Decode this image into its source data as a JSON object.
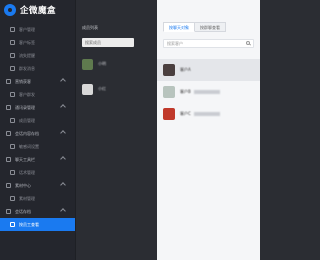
{
  "brand": {
    "title": "企微魔盒"
  },
  "sidebar": {
    "items": [
      {
        "label": "客户管理",
        "kind": "sub"
      },
      {
        "label": "客户标签",
        "kind": "sub"
      },
      {
        "label": "流失提醒",
        "kind": "sub"
      },
      {
        "label": "群发消息",
        "kind": "sub"
      },
      {
        "label": "营销获客",
        "kind": "group"
      },
      {
        "label": "客户群发",
        "kind": "sub"
      },
      {
        "label": "通讯录管理",
        "kind": "group"
      },
      {
        "label": "成员管理",
        "kind": "sub"
      },
      {
        "label": "会话内容存档",
        "kind": "group"
      },
      {
        "label": "敏感词设置",
        "kind": "sub"
      },
      {
        "label": "聊天工具栏",
        "kind": "group"
      },
      {
        "label": "话术管理",
        "kind": "sub"
      },
      {
        "label": "素材中心",
        "kind": "group"
      },
      {
        "label": "素材管理",
        "kind": "sub"
      },
      {
        "label": "会话存档",
        "kind": "group"
      },
      {
        "label": "按员工查看",
        "kind": "sub",
        "active": true
      }
    ]
  },
  "members": {
    "title": "成员列表",
    "search_placeholder": "搜索成员",
    "items": [
      {
        "name": "小明",
        "avatar_color": "#5f7a4e"
      },
      {
        "name": "小红",
        "avatar_color": "#d8d8d8"
      }
    ]
  },
  "chats": {
    "tabs": [
      {
        "label": "按聊天对象",
        "active": true
      },
      {
        "label": "按群聊查看",
        "active": false
      }
    ],
    "search_placeholder": "搜索客户",
    "items": [
      {
        "name": "客户A",
        "avatar_color": "#4a3f3f",
        "selected": true
      },
      {
        "name": "客户B",
        "avatar_color": "#b8c4be",
        "selected": false
      },
      {
        "name": "客户C",
        "avatar_color": "#c0392b",
        "selected": false
      }
    ]
  },
  "colors": {
    "accent": "#1a7af0",
    "sidebar_bg": "#24262d",
    "panel_bg": "#2b2d33"
  }
}
